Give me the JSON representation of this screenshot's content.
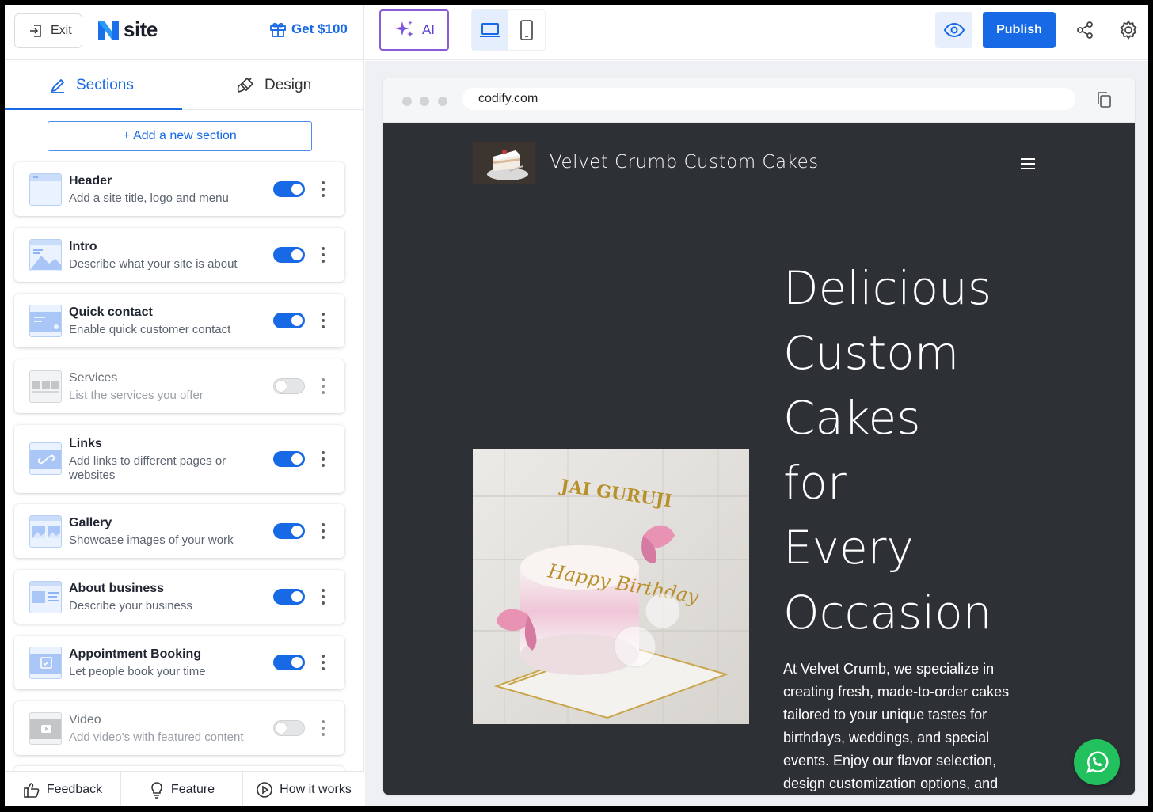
{
  "app": {
    "exit_label": "Exit",
    "logo_text": "site",
    "promo_label": "Get $100",
    "tabs": [
      {
        "label": "Sections",
        "active": true
      },
      {
        "label": "Design",
        "active": false
      }
    ],
    "add_section_label": "+ Add a new section",
    "sections": [
      {
        "title": "Header",
        "desc": "Add a site title, logo and menu",
        "enabled": true
      },
      {
        "title": "Intro",
        "desc": "Describe what your site is about",
        "enabled": true
      },
      {
        "title": "Quick contact",
        "desc": "Enable quick customer contact",
        "enabled": true
      },
      {
        "title": "Services",
        "desc": "List the services you offer",
        "enabled": false
      },
      {
        "title": "Links",
        "desc": "Add links to different pages or websites",
        "enabled": true
      },
      {
        "title": "Gallery",
        "desc": "Showcase images of your work",
        "enabled": true
      },
      {
        "title": "About business",
        "desc": "Describe your business",
        "enabled": true
      },
      {
        "title": "Appointment Booking",
        "desc": "Let people book your time",
        "enabled": true
      },
      {
        "title": "Video",
        "desc": "Add video's with featured content",
        "enabled": false
      }
    ],
    "bottom_bar": {
      "feedback": "Feedback",
      "feature": "Feature",
      "how_it_works": "How it works"
    }
  },
  "toolbar": {
    "ai_label": "AI",
    "publish_label": "Publish"
  },
  "preview": {
    "url": "codify.com",
    "site_name": "Velvet Crumb Custom Cakes",
    "hero_title_lines": [
      "Delicious",
      "Custom",
      "Cakes",
      "for",
      "Every",
      "Occasion"
    ],
    "hero_text": "At Velvet Crumb, we specialize in creating fresh, made-to-order cakes tailored to your unique tastes for birthdays, weddings, and special events. Enjoy our flavor selection, design customization options, and",
    "cake_topper_text": "JAI GURUJI",
    "cake_topper_text_2": "Happy Birthday"
  },
  "colors": {
    "accent": "#1769e6",
    "ai_border": "#8a5bd6",
    "site_bg": "#2d3136",
    "whatsapp": "#22c15e"
  }
}
